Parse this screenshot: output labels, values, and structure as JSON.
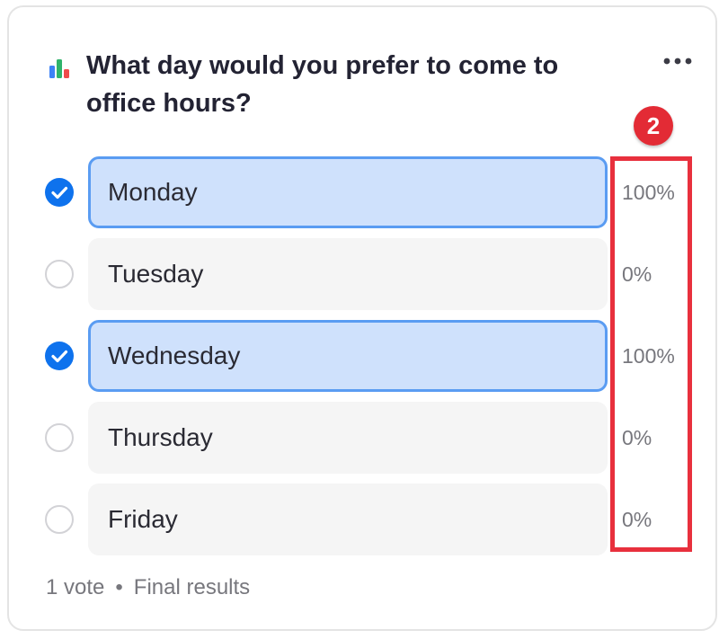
{
  "poll": {
    "question": "What day would you prefer to come to office hours?",
    "options": [
      {
        "label": "Monday",
        "percent": "100%",
        "selected": true
      },
      {
        "label": "Tuesday",
        "percent": "0%",
        "selected": false
      },
      {
        "label": "Wednesday",
        "percent": "100%",
        "selected": true
      },
      {
        "label": "Thursday",
        "percent": "0%",
        "selected": false
      },
      {
        "label": "Friday",
        "percent": "0%",
        "selected": false
      }
    ],
    "footer": {
      "votes": "1 vote",
      "separator": "•",
      "status": "Final results"
    }
  },
  "annotation": {
    "badge": "2"
  },
  "icons": {
    "poll": "bar-chart-icon",
    "more": "more-horizontal-icon",
    "checked": "checkmark-circle-icon",
    "unchecked": "empty-circle-icon"
  },
  "colors": {
    "accent": "#0e72ed",
    "selected_fill": "#cfe1fc",
    "selected_border": "#5a9cf2",
    "annotation_red": "#e8303d",
    "bar_blue": "#3d82f6",
    "bar_green": "#2fb36b",
    "bar_red": "#ef4b4b"
  }
}
